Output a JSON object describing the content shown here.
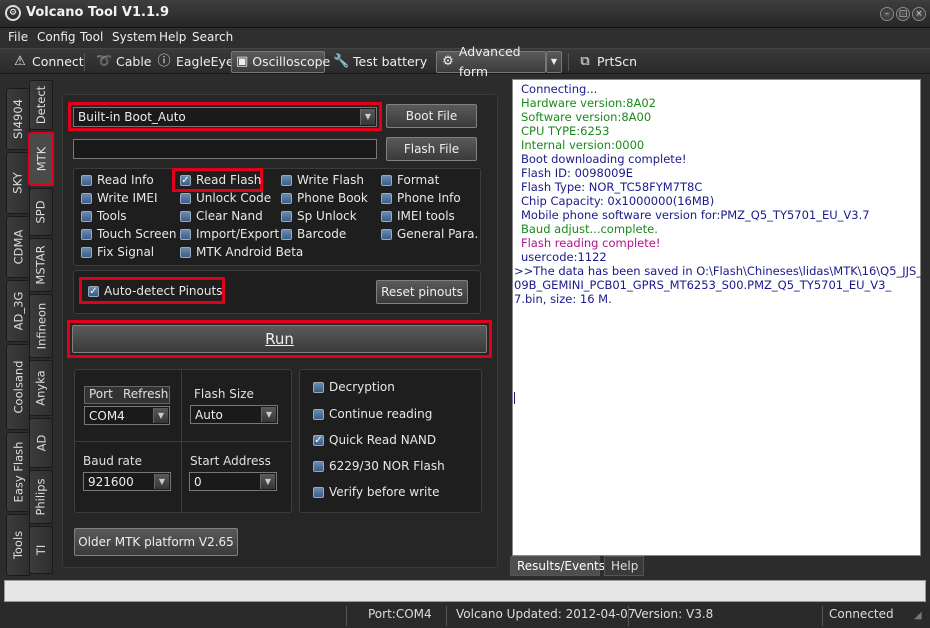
{
  "window": {
    "title": "Volcano Tool V1.1.9",
    "logo": "volcano-logo",
    "controls": [
      "minimize",
      "maximize",
      "close"
    ]
  },
  "menu": [
    "File",
    "Config",
    "Tool",
    "System",
    "Help",
    "Search"
  ],
  "toolbar": {
    "items": [
      {
        "label": "Connect",
        "icon": "warning-icon"
      },
      {
        "label": "Cable",
        "icon": "cable-icon"
      },
      {
        "label": "EagleEye",
        "icon": "info-icon"
      },
      {
        "label": "Oscilloscope",
        "icon": "oscilloscope-icon",
        "active": true
      },
      {
        "label": "Test battery",
        "icon": "wrench-icon"
      },
      {
        "label": "Advanced form",
        "icon": "gear-icon"
      },
      {
        "label": "PrtScn",
        "icon": "screenshot-icon"
      }
    ]
  },
  "side_tabs_outer": [
    "SI4904",
    "SKY",
    "CDMA",
    "AD_3G",
    "Coolsand",
    "Easy Flash",
    "Tools"
  ],
  "side_tabs_inner": [
    "Detect",
    "MTK",
    "SPD",
    "MSTAR",
    "Infineon",
    "Anyka",
    "AD",
    "Philips",
    "TI"
  ],
  "selected_tab": "MTK",
  "boot": {
    "value": "Built-in Boot_Auto",
    "boot_file_label": "Boot File",
    "flash_file_label": "Flash File",
    "flash_file_value": ""
  },
  "functions": [
    {
      "label": "Read Info",
      "checked": false
    },
    {
      "label": "Read Flash",
      "checked": true
    },
    {
      "label": "Write Flash",
      "checked": false
    },
    {
      "label": "Format",
      "checked": false
    },
    {
      "label": "Write IMEI",
      "checked": false
    },
    {
      "label": "Unlock Code",
      "checked": false
    },
    {
      "label": "Phone Book",
      "checked": false
    },
    {
      "label": "Phone Info",
      "checked": false
    },
    {
      "label": "Tools",
      "checked": false
    },
    {
      "label": "Clear Nand",
      "checked": false
    },
    {
      "label": "Sp Unlock",
      "checked": false
    },
    {
      "label": "IMEI tools",
      "checked": false
    },
    {
      "label": "Touch Screen",
      "checked": false
    },
    {
      "label": "Import/Export",
      "checked": false
    },
    {
      "label": "Barcode",
      "checked": false
    },
    {
      "label": "General Para.",
      "checked": false
    },
    {
      "label": "Fix Signal",
      "checked": false
    },
    {
      "label": "MTK Android Beta",
      "checked": false
    }
  ],
  "pinouts": {
    "label": "Auto-detect Pinouts",
    "checked": true,
    "reset_label": "Reset pinouts"
  },
  "run_label": "Run",
  "settings": {
    "port_label": "Port",
    "refresh_label": "Refresh",
    "port_value": "COM4",
    "flash_size_label": "Flash Size",
    "flash_size_value": "Auto",
    "baud_label": "Baud rate",
    "baud_value": "921600",
    "start_address_label": "Start Address",
    "start_address_value": "0"
  },
  "options": [
    {
      "label": "Decryption",
      "checked": false
    },
    {
      "label": "Continue reading",
      "checked": false
    },
    {
      "label": "Quick Read NAND",
      "checked": true
    },
    {
      "label": "6229/30 NOR Flash",
      "checked": false
    },
    {
      "label": "Verify before write",
      "checked": false
    }
  ],
  "older_platform_label": "Older MTK platform V2.65",
  "log": [
    {
      "text": "Connecting...",
      "color": "#1a1a8c"
    },
    {
      "text": "Hardware version:8A02",
      "color": "#1a8a1a"
    },
    {
      "text": "Software version:8A00",
      "color": "#1a8a1a"
    },
    {
      "text": "CPU TYPE:6253",
      "color": "#1a8a1a"
    },
    {
      "text": "Internal version:0000",
      "color": "#1a8a1a"
    },
    {
      "text": "Boot downloading complete!",
      "color": "#1a1a8c"
    },
    {
      "text": "Flash ID: 0098009E",
      "color": "#1a1a8c"
    },
    {
      "text": "Flash Type:  NOR_TC58FYM7T8C",
      "color": "#1a1a8c"
    },
    {
      "text": "Chip Capacity: 0x1000000(16MB)",
      "color": "#1a1a8c"
    },
    {
      "text": "Mobile phone software version for:PMZ_Q5_TY5701_EU_V3.7",
      "color": "#1a1a8c"
    },
    {
      "text": "Baud adjust...complete.",
      "color": "#1a8a1a"
    },
    {
      "text": "Flash reading complete!",
      "color": "#b0108c"
    },
    {
      "text": "usercode:1122",
      "color": "#1a1a8c"
    },
    {
      "text": ">>The data has been saved in O:\\Flash\\Chineses\\lidas\\MTK\\16\\Q5_JJS_",
      "color": "#1a1a8c"
    },
    {
      "text": "09B_GEMINI_PCB01_GPRS_MT6253_S00.PMZ_Q5_TY5701_EU_V3_",
      "color": "#1a1a8c"
    },
    {
      "text": "7.bin, size: 16 M.",
      "color": "#1a1a8c"
    }
  ],
  "log_tabs": [
    "Results/Events",
    "Help"
  ],
  "status": {
    "port": "Port:COM4",
    "updated": "Volcano Updated: 2012-04-07",
    "version": "Version: V3.8",
    "connection": "Connected"
  }
}
